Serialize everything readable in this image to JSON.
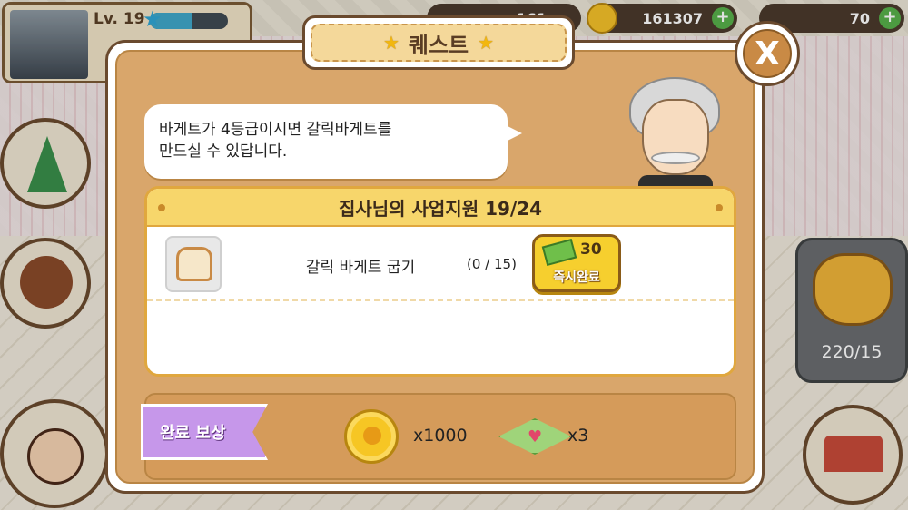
{
  "hud": {
    "level_label": "Lv. 19",
    "resource_top": "161",
    "coins": "161307",
    "cash": "70"
  },
  "side": {
    "tiger_count": "220/15"
  },
  "dialog": {
    "title": "퀘스트",
    "close_label": "X",
    "speech": "바게트가 4등급이시면 갈릭바게트를\n만드실 수 있답니다.",
    "quest_title": "집사님의 사업지원 19/24",
    "tasks": [
      {
        "name": "갈릭 바게트 굽기",
        "progress": "(0 / 15)",
        "instant_cost": "30",
        "instant_label": "즉시완료"
      }
    ],
    "reward_label": "완료 보상",
    "rewards": [
      {
        "icon": "coin-icon",
        "qty": "x1000"
      },
      {
        "icon": "gem-heart-icon",
        "qty": "x3"
      }
    ]
  },
  "colors": {
    "dialog_frame": "#d9a66b",
    "quest_header": "#f7d66b",
    "instant_button": "#f6cf2e",
    "reward_tag": "#c697ea"
  }
}
